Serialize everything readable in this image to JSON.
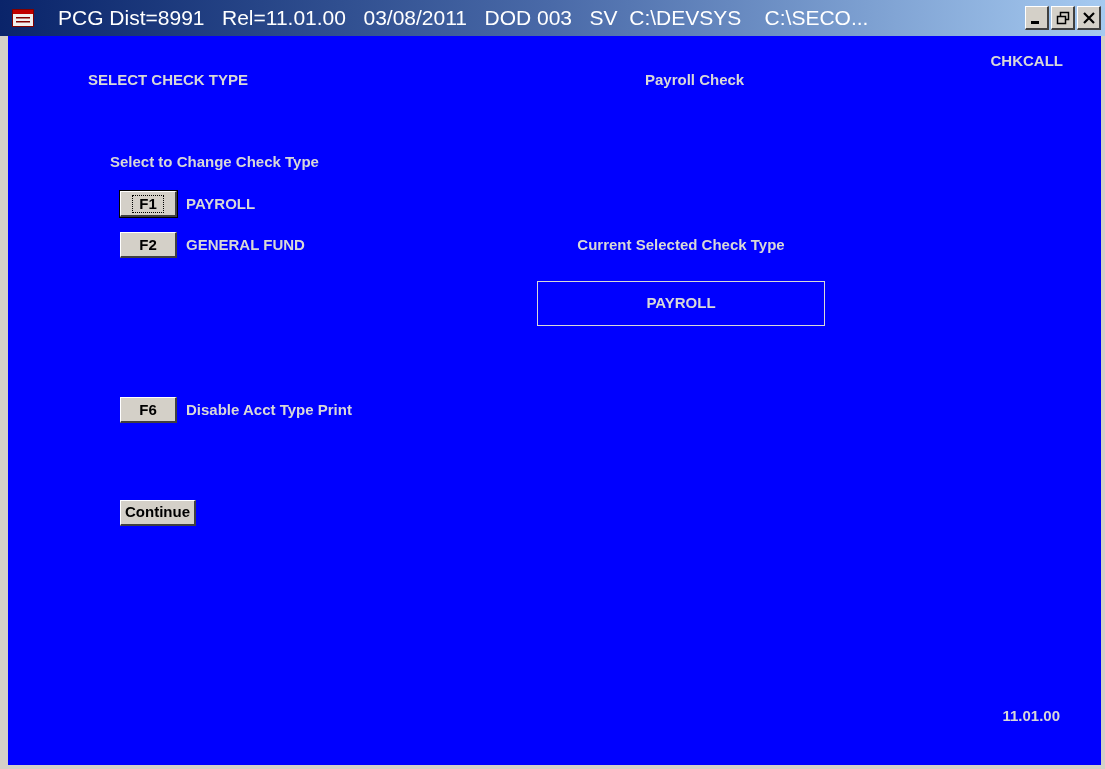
{
  "window": {
    "title": "PCG Dist=8991   Rel=11.01.00   03/08/2011   DOD 003   SV  C:\\DEVSYS    C:\\SECO..."
  },
  "screen_code": "CHKCALL",
  "heading": "SELECT CHECK TYPE",
  "subheading": "Payroll Check",
  "select_label": "Select to Change Check Type",
  "check_types": [
    {
      "key": "F1",
      "label": "PAYROLL",
      "focused": true
    },
    {
      "key": "F2",
      "label": "GENERAL FUND",
      "focused": false
    }
  ],
  "current": {
    "label": "Current Selected Check Type",
    "value": "PAYROLL"
  },
  "options": [
    {
      "key": "F6",
      "label": "Disable Acct Type Print",
      "focused": false
    }
  ],
  "continue_button": "Continue",
  "version": "11.01.00"
}
